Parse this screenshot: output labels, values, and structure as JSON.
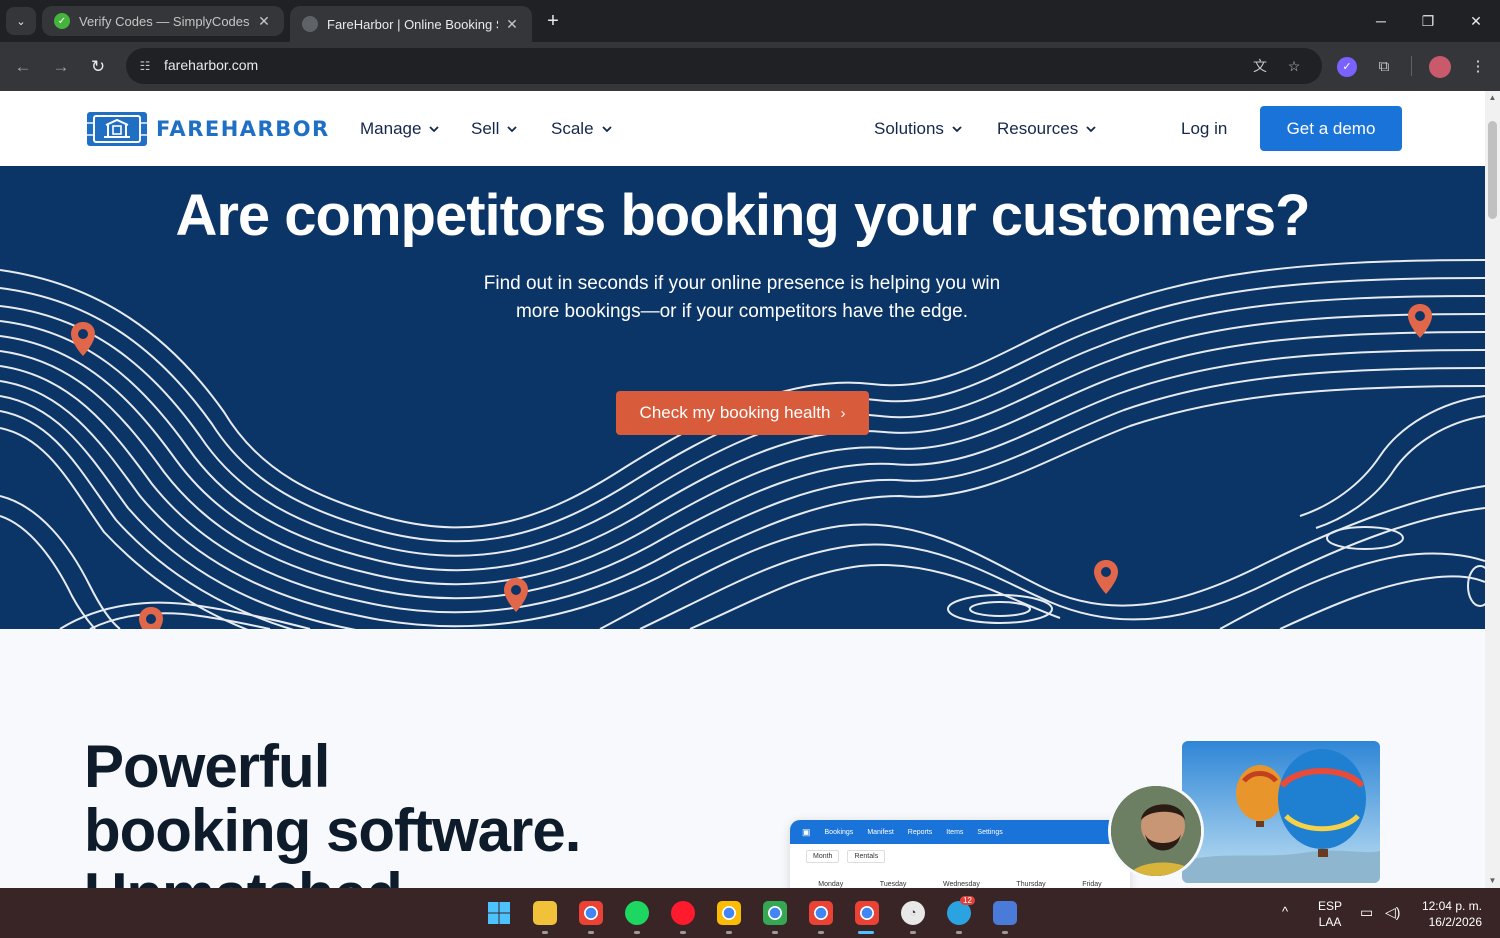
{
  "browser": {
    "tabs": [
      {
        "title": "Verify Codes — SimplyCodes",
        "active": false,
        "favicon": "simplycodes-icon"
      },
      {
        "title": "FareHarbor | Online Booking So",
        "active": true,
        "favicon": "fareharbor-icon"
      }
    ],
    "url": "fareharbor.com"
  },
  "site": {
    "logo_text": "FAREHARBOR",
    "nav_left": [
      {
        "label": "Manage"
      },
      {
        "label": "Sell"
      },
      {
        "label": "Scale"
      }
    ],
    "nav_right": [
      {
        "label": "Solutions"
      },
      {
        "label": "Resources"
      }
    ],
    "login": "Log in",
    "demo_button": "Get a demo"
  },
  "hero": {
    "title": "Are competitors booking your customers?",
    "subtitle_line1": "Find out in seconds if your online presence is helping you win",
    "subtitle_line2": "more bookings—or if your competitors have the edge.",
    "cta": "Check my booking health",
    "cta_arrow": "›"
  },
  "features": {
    "title_line1": "Powerful",
    "title_line2": "booking software.",
    "title_line3": "Unmatched",
    "mock_nav": [
      "Bookings",
      "Manifest",
      "Reports",
      "Items",
      "Settings"
    ],
    "mock_filters": [
      "Month",
      "Rentals"
    ],
    "mock_days": [
      "Monday",
      "Tuesday",
      "Wednesday",
      "Thursday",
      "Friday"
    ]
  },
  "taskbar": {
    "lang_line1": "ESP",
    "lang_line2": "LAA",
    "time": "12:04 p. m.",
    "date": "16/2/2026",
    "telegram_badge": "12"
  },
  "colors": {
    "hero_bg": "#0b3566",
    "brand_blue": "#1a73d9",
    "cta_orange": "#d85b3c",
    "pin_orange": "#e0674a"
  }
}
